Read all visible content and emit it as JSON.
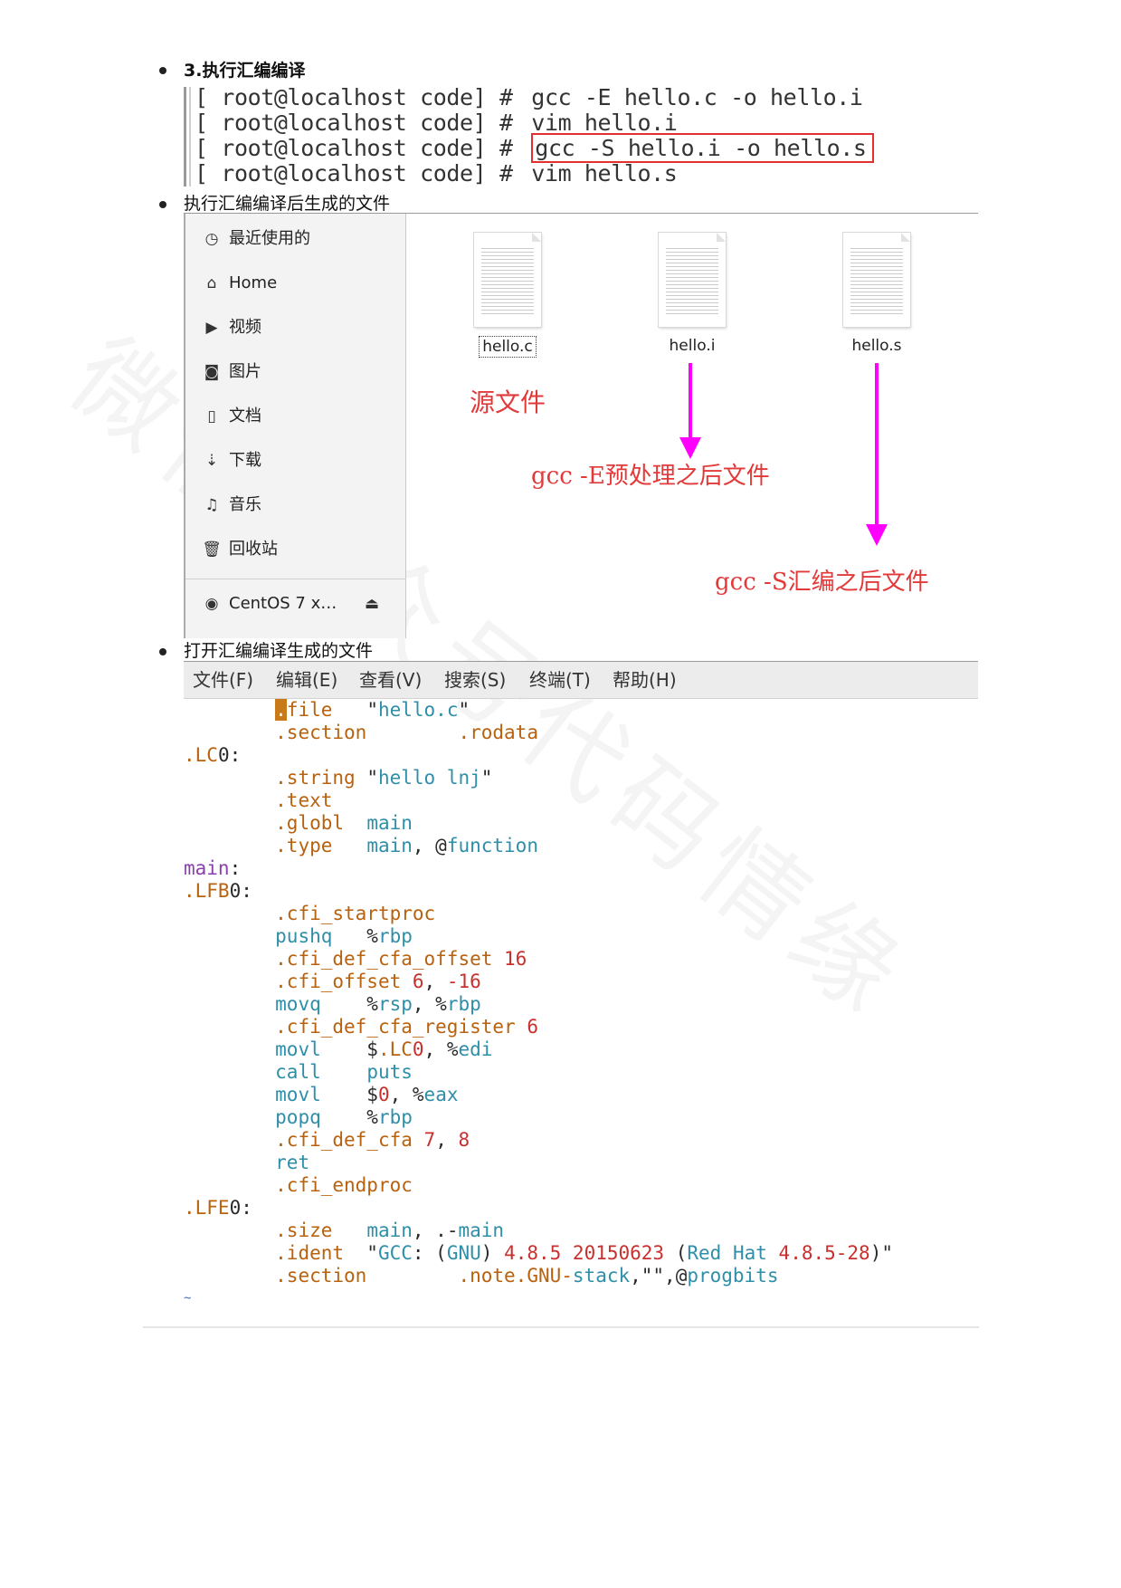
{
  "sections": {
    "step3_title": "3.执行汇编编译",
    "files_title": "执行汇编编译后生成的文件",
    "open_title": "打开汇编编译生成的文件"
  },
  "terminal": {
    "prompt": "[ root@localhost code] #",
    "commands": [
      "gcc -E hello.c -o hello.i",
      "vim hello.i",
      "gcc -S hello.i -o hello.s",
      "vim hello.s"
    ]
  },
  "file_manager": {
    "sidebar": [
      {
        "icon": "clock-icon",
        "label": "最近使用的"
      },
      {
        "icon": "home-icon",
        "label": "Home"
      },
      {
        "icon": "video-icon",
        "label": "视频"
      },
      {
        "icon": "camera-icon",
        "label": "图片"
      },
      {
        "icon": "document-icon",
        "label": "文档"
      },
      {
        "icon": "download-icon",
        "label": "下载"
      },
      {
        "icon": "music-icon",
        "label": "音乐"
      },
      {
        "icon": "trash-icon",
        "label": "回收站"
      }
    ],
    "device": {
      "label": "CentOS 7 x…",
      "icon": "disc-icon",
      "eject_icon": "eject-icon"
    },
    "files": [
      "hello.c",
      "hello.i",
      "hello.s"
    ],
    "annotations": {
      "source": "源文件",
      "preprocess": "gcc -E预处理之后文件",
      "assemble": "gcc -S汇编之后文件"
    },
    "arrow_color": "#ff00ff",
    "note_color": "#e23a3a"
  },
  "editor": {
    "menu": [
      "文件(F)",
      "编辑(E)",
      "查看(V)",
      "搜索(S)",
      "终端(T)",
      "帮助(H)"
    ],
    "tilde": "~"
  },
  "watermark": "微信公众号代码情缘"
}
